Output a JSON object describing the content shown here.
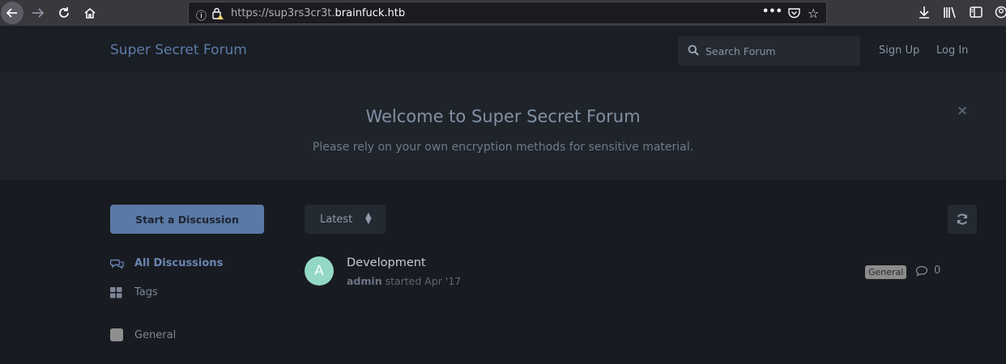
{
  "browser": {
    "url_prefix": "https://sup3rs3cr3t.",
    "url_domain": "brainfuck.htb",
    "icons": [
      "back-arrow-icon",
      "forward-arrow-icon",
      "reload-icon",
      "home-icon",
      "info-icon",
      "insecure-lock-icon",
      "more-icon",
      "pocket-icon",
      "bookmark-star-icon",
      "download-icon",
      "library-icon",
      "sidebar-icon",
      "account-icon"
    ]
  },
  "header": {
    "brand": "Super Secret Forum",
    "search_placeholder": "Search Forum",
    "sign_up": "Sign Up",
    "log_in": "Log In"
  },
  "hero": {
    "title": "Welcome to Super Secret Forum",
    "subtitle": "Please rely on your own encryption methods for sensitive material.",
    "close_glyph": "×"
  },
  "sidebar": {
    "start_button": "Start a Discussion",
    "nav": [
      {
        "label": "All Discussions",
        "icon": "comments-icon"
      },
      {
        "label": "Tags",
        "icon": "th-large-icon"
      }
    ],
    "tags": [
      {
        "label": "General",
        "color": "#8f8f8f"
      }
    ]
  },
  "toolbar": {
    "sort_label": "Latest"
  },
  "discussions": [
    {
      "avatar_letter": "A",
      "avatar_color": "#93d8c5",
      "title": "Development",
      "author": "admin",
      "meta": " started Apr '17",
      "tag": "General",
      "reply_count": "0"
    }
  ],
  "colors": {
    "brand": "#5e7ba8",
    "primary_button": "#5a7aa6",
    "background": "#181b21"
  }
}
